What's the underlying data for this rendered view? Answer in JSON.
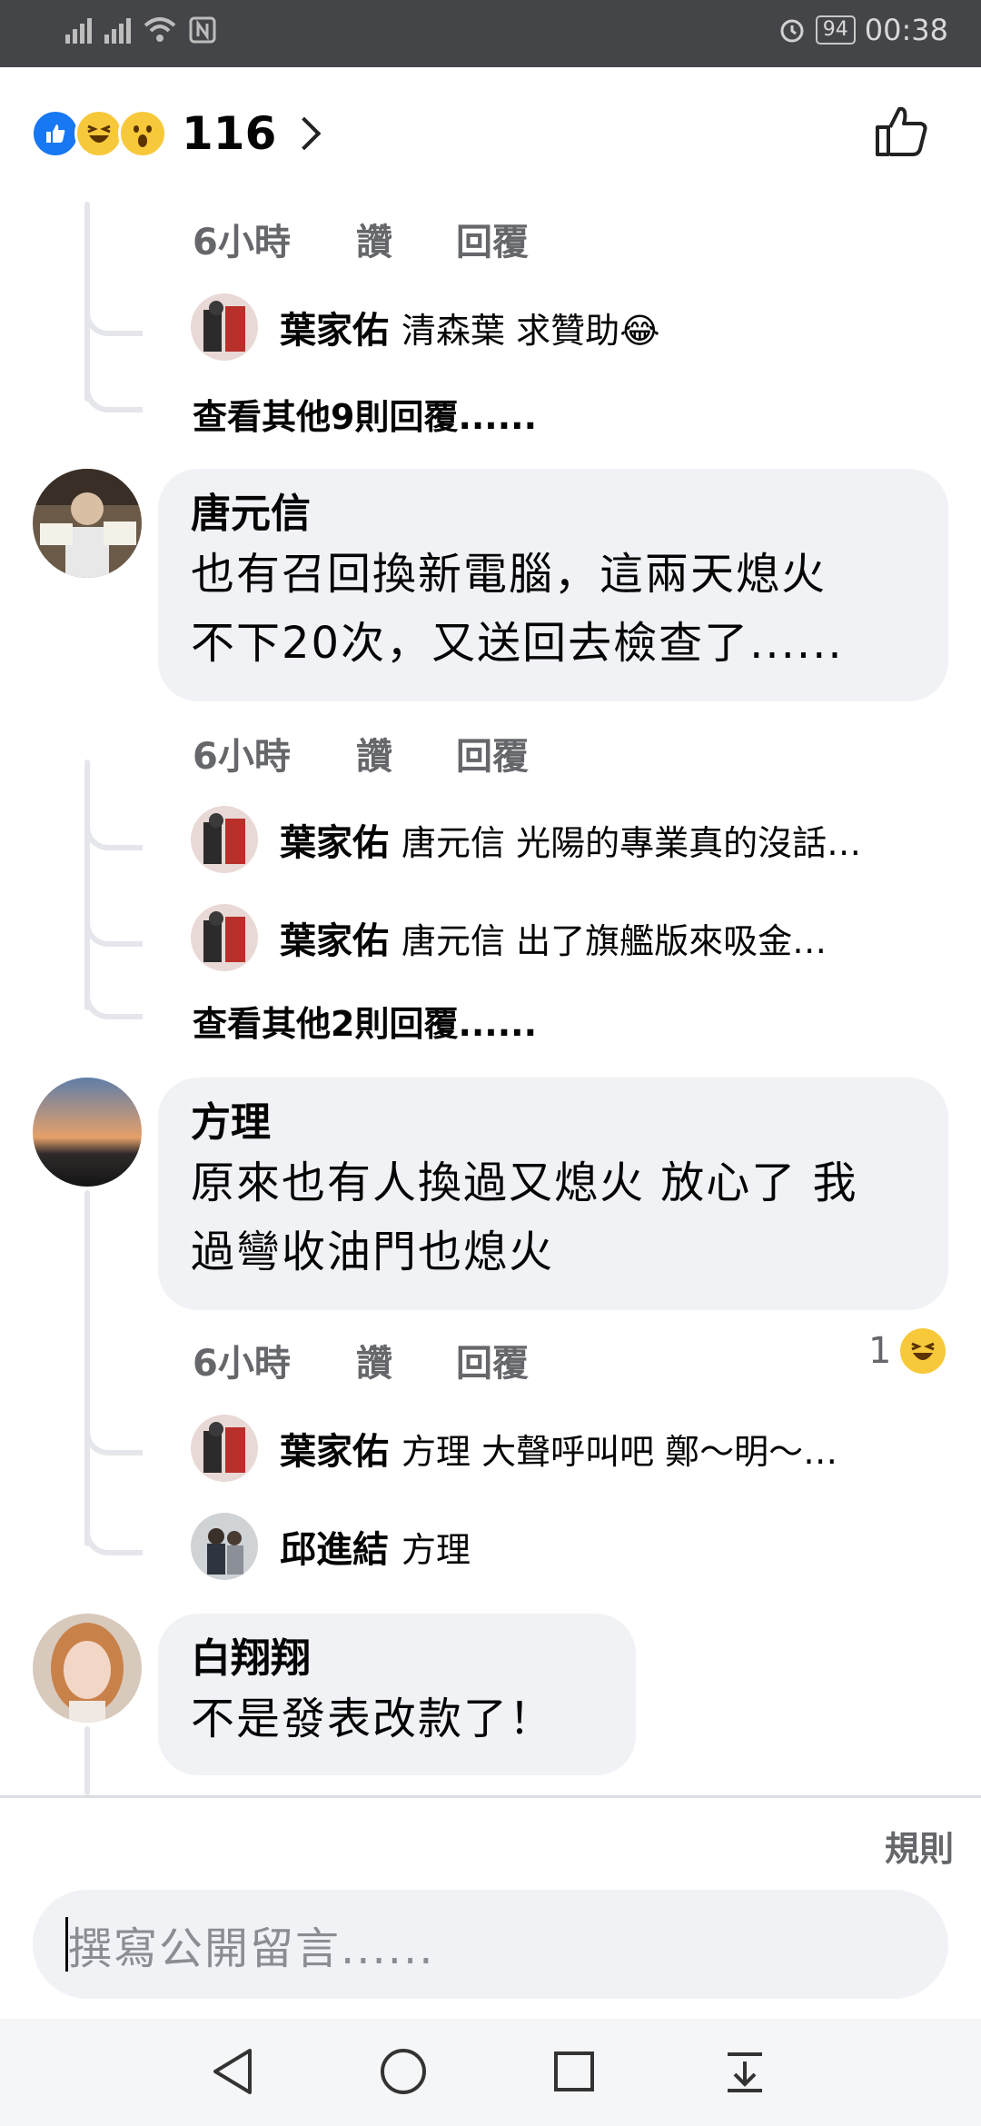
{
  "status_bar": {
    "battery": "94",
    "time": "00:38"
  },
  "header": {
    "reaction_count": "116",
    "reaction_icons": [
      "like-icon",
      "haha-icon",
      "wow-icon"
    ]
  },
  "thread1": {
    "meta": {
      "time": "6小時",
      "like": "讚",
      "reply": "回覆"
    },
    "replies": [
      {
        "name": "葉家佑",
        "text": "清森葉 求贊助😂"
      }
    ],
    "more": "查看其他9則回覆......"
  },
  "comments": [
    {
      "name": "唐元信",
      "lines": [
        "也有召回換新電腦，這兩天熄火",
        "不下20次，又送回去檢查了......"
      ],
      "meta": {
        "time": "6小時",
        "like": "讚",
        "reply": "回覆"
      },
      "replies": [
        {
          "name": "葉家佑",
          "text": "唐元信 光陽的專業真的沒話…"
        },
        {
          "name": "葉家佑",
          "text": "唐元信 出了旗艦版來吸金…"
        }
      ],
      "more": "查看其他2則回覆......"
    },
    {
      "name": "方理",
      "lines": [
        "原來也有人換過又熄火 放心了 我",
        "過彎收油門也熄火"
      ],
      "meta": {
        "time": "6小時",
        "like": "讚",
        "reply": "回覆"
      },
      "reaction_count": "1",
      "replies": [
        {
          "name": "葉家佑",
          "text": "方理 大聲呼叫吧 鄭～明～…"
        },
        {
          "name": "邱進結",
          "text": "方理"
        }
      ]
    },
    {
      "name": "白翔翔",
      "lines": [
        "不是發表改款了！"
      ]
    }
  ],
  "composer": {
    "rules": "規則",
    "placeholder": "撰寫公開留言......"
  }
}
